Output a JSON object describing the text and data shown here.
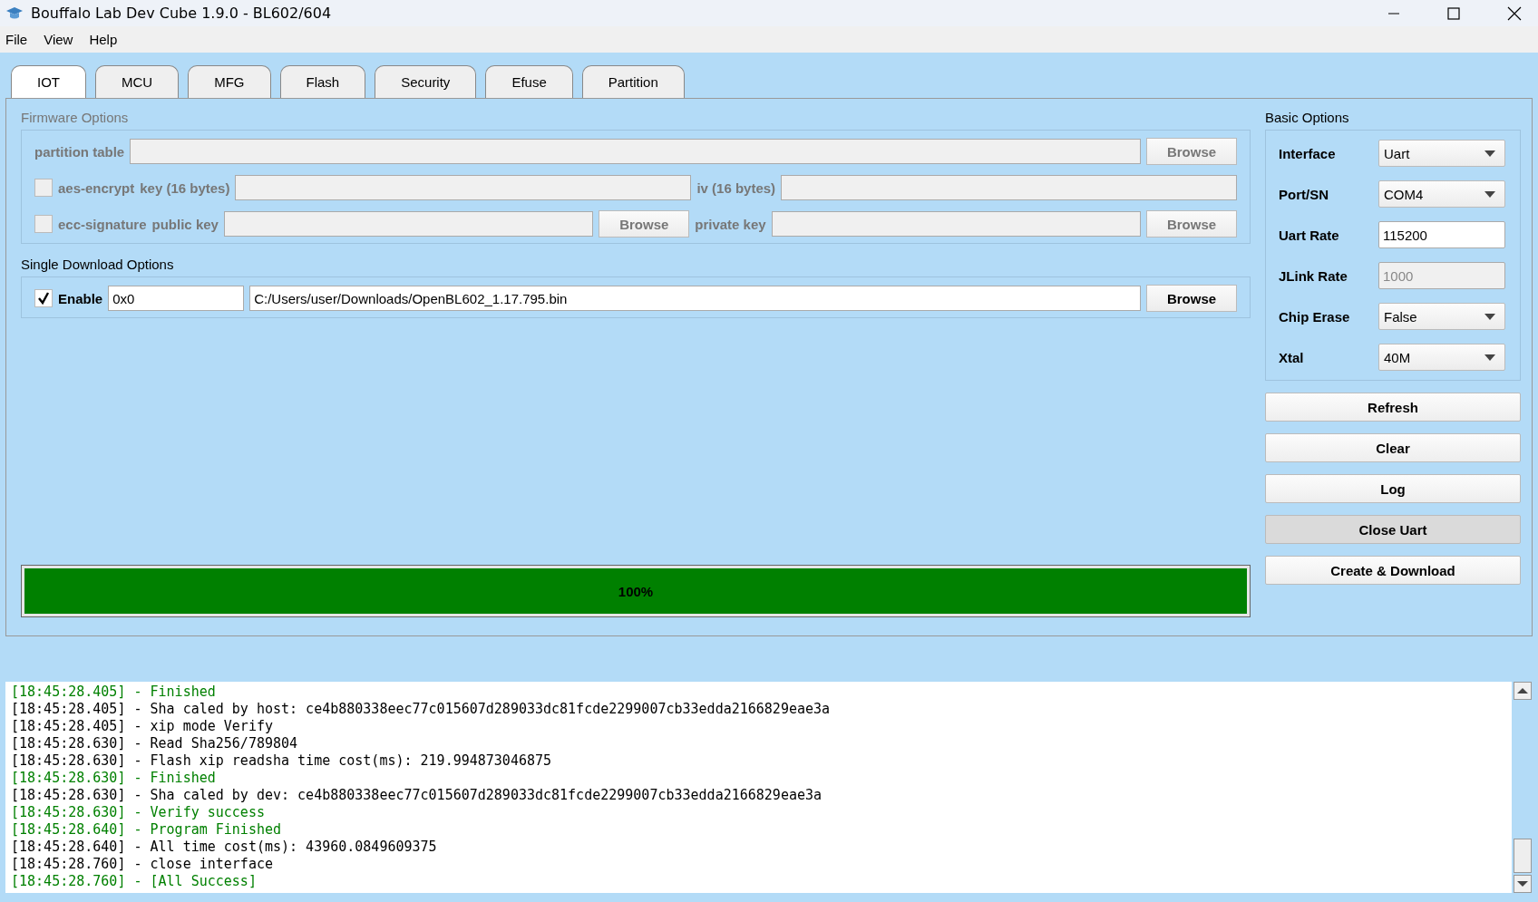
{
  "window": {
    "title": "Bouffalo Lab Dev Cube 1.9.0 - BL602/604"
  },
  "menu": [
    {
      "label": "File"
    },
    {
      "label": "View"
    },
    {
      "label": "Help"
    }
  ],
  "tabs": [
    {
      "label": "IOT",
      "selected": true
    },
    {
      "label": "MCU",
      "selected": false
    },
    {
      "label": "MFG",
      "selected": false
    },
    {
      "label": "Flash",
      "selected": false
    },
    {
      "label": "Security",
      "selected": false
    },
    {
      "label": "Efuse",
      "selected": false
    },
    {
      "label": "Partition",
      "selected": false
    }
  ],
  "firmware_options": {
    "title": "Firmware Options",
    "disabled": true,
    "partition_table": {
      "label": "partition table",
      "button": "Browse"
    },
    "aes_encrypt": {
      "label": "aes-encrypt",
      "checked": false,
      "key_label": "key (16 bytes)",
      "iv_label": "iv (16 bytes)"
    },
    "ecc_signature": {
      "label": "ecc-signature",
      "checked": false,
      "public_key_label": "public key",
      "public_button": "Browse",
      "private_key_label": "private key",
      "private_button": "Browse"
    }
  },
  "single_download": {
    "title": "Single Download Options",
    "enable": {
      "label": "Enable",
      "checked": true
    },
    "address": "0x0",
    "file": "C:/Users/user/Downloads/OpenBL602_1.17.795.bin",
    "button": "Browse"
  },
  "progress": {
    "level": 1.0,
    "text": "100%"
  },
  "basic_options": {
    "title": "Basic Options",
    "fields": [
      {
        "label": "Interface",
        "kind": "dropdown",
        "value": "Uart",
        "disabled": false
      },
      {
        "label": "Port/SN",
        "kind": "dropdown",
        "value": "COM4",
        "disabled": false
      },
      {
        "label": "Uart Rate",
        "kind": "text",
        "value": "115200",
        "disabled": false
      },
      {
        "label": "JLink Rate",
        "kind": "text",
        "value": "1000",
        "disabled": true
      },
      {
        "label": "Chip Erase",
        "kind": "dropdown",
        "value": "False",
        "disabled": false
      },
      {
        "label": "Xtal",
        "kind": "dropdown",
        "value": "40M",
        "disabled": false
      }
    ]
  },
  "buttons": [
    {
      "label": "Refresh",
      "pressed": false
    },
    {
      "label": "Clear",
      "pressed": false
    },
    {
      "label": "Log",
      "pressed": false
    },
    {
      "label": "Close Uart",
      "pressed": true
    },
    {
      "label": "Create & Download",
      "pressed": false
    }
  ],
  "log": [
    {
      "text": "[18:45:28.405] - Finished",
      "kind": "success"
    },
    {
      "text": "[18:45:28.405] - Sha caled by host: ce4b880338eec77c015607d289033dc81fcde2299007cb33edda2166829eae3a",
      "kind": "info"
    },
    {
      "text": "[18:45:28.405] - xip mode Verify",
      "kind": "info"
    },
    {
      "text": "[18:45:28.630] - Read Sha256/789804",
      "kind": "info"
    },
    {
      "text": "[18:45:28.630] - Flash xip readsha time cost(ms): 219.994873046875",
      "kind": "info"
    },
    {
      "text": "[18:45:28.630] - Finished",
      "kind": "success"
    },
    {
      "text": "[18:45:28.630] - Sha caled by dev: ce4b880338eec77c015607d289033dc81fcde2299007cb33edda2166829eae3a",
      "kind": "info"
    },
    {
      "text": "[18:45:28.630] - Verify success",
      "kind": "success"
    },
    {
      "text": "[18:45:28.640] - Program Finished",
      "kind": "success"
    },
    {
      "text": "[18:45:28.640] - All time cost(ms): 43960.0849609375",
      "kind": "info"
    },
    {
      "text": "[18:45:28.760] - close interface",
      "kind": "info"
    },
    {
      "text": "[18:45:28.760] - [All Success]",
      "kind": "success"
    }
  ]
}
